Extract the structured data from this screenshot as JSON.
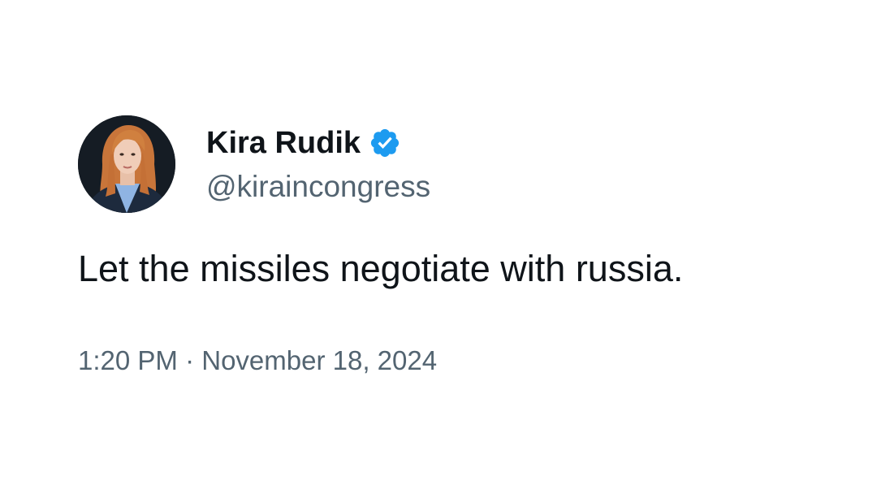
{
  "tweet": {
    "author": {
      "display_name": "Kira Rudik",
      "handle": "@kiraincongress",
      "verified": true,
      "verified_icon": "verified-badge-icon",
      "verified_color": "#1d9bf0"
    },
    "text": "Let the missiles negotiate with russia.",
    "time": "1:20 PM",
    "separator": "·",
    "date": "November 18, 2024"
  }
}
